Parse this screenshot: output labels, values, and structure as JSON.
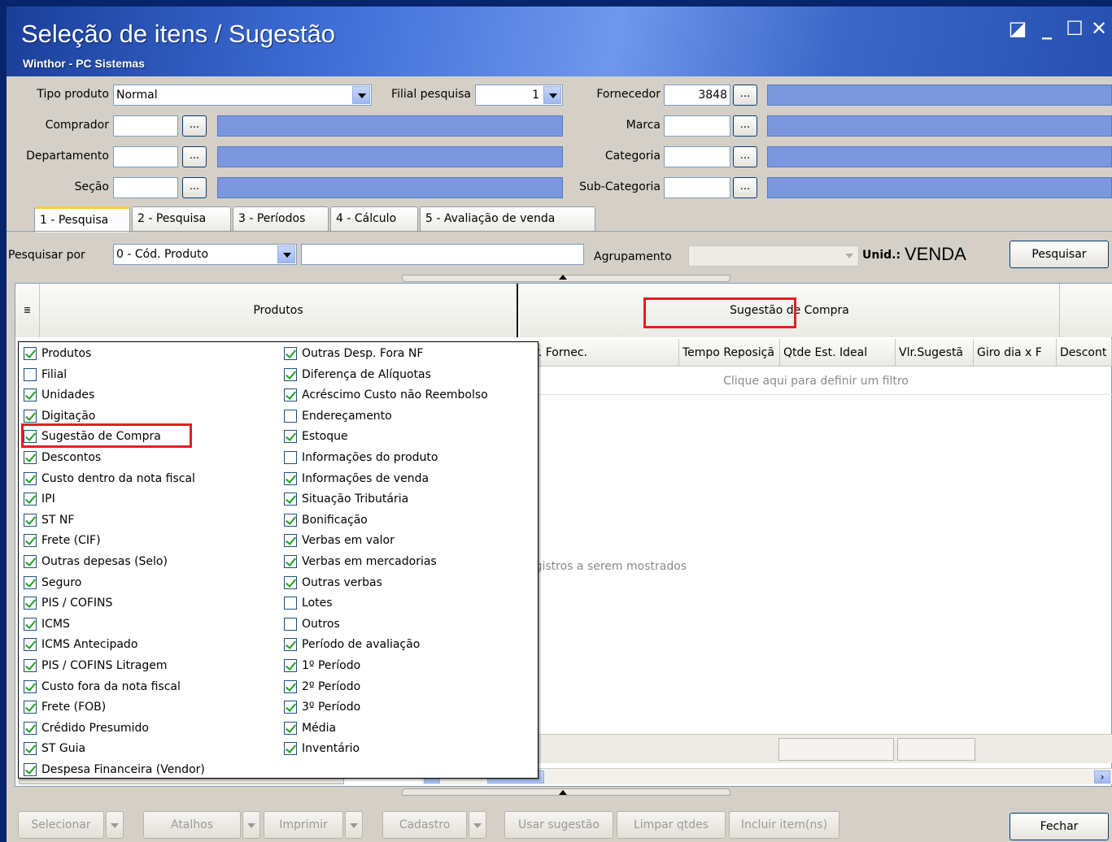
{
  "window": {
    "title": "Seleção de itens / Sugestão",
    "subtitle": "Winthor - PC Sistemas",
    "controls": [
      "◪",
      "_",
      "☐",
      "✕"
    ]
  },
  "filters": {
    "tipo_produto_label": "Tipo produto",
    "tipo_produto_value": "Normal",
    "filial_label": "Filial pesquisa",
    "filial_value": "1",
    "fornecedor_label": "Fornecedor",
    "fornecedor_value": "3848",
    "comprador_label": "Comprador",
    "marca_label": "Marca",
    "departamento_label": "Departamento",
    "categoria_label": "Categoria",
    "secao_label": "Seção",
    "subcategoria_label": "Sub-Categoria",
    "ellipsis": "..."
  },
  "tabs": [
    {
      "label": "1 - Pesquisa"
    },
    {
      "label": "2 - Pesquisa"
    },
    {
      "label": "3 - Períodos"
    },
    {
      "label": "4 - Cálculo"
    },
    {
      "label": "5 - Avaliação de venda"
    }
  ],
  "search": {
    "pesquisar_por_label": "Pesquisar por",
    "pesquisar_por_value": "0 - Cód. Produto",
    "agrupamento_label": "Agrupamento",
    "unid_label": "Unid.:",
    "unid_value": "VENDA",
    "pesquisar_button": "Pesquisar"
  },
  "grid": {
    "band_produtos": "Produtos",
    "band_sugestao": "Sugestão de Compra",
    "columns": [
      "ntr. Fornec.",
      "Tempo Reposiçã",
      "Qtde Est. Ideal",
      "Vlr.Sugestã",
      "Giro dia x F",
      "Descont"
    ],
    "filter_hint": "Clique aqui para definir um filtro",
    "empty_text": "egistros a serem mostrados"
  },
  "popup": {
    "left_items": [
      {
        "label": "Produtos",
        "checked": true
      },
      {
        "label": "Filial",
        "checked": false
      },
      {
        "label": "Unidades",
        "checked": true
      },
      {
        "label": "Digitação",
        "checked": true
      },
      {
        "label": "Sugestão de Compra",
        "checked": true
      },
      {
        "label": "Descontos",
        "checked": true
      },
      {
        "label": "Custo dentro da nota fiscal",
        "checked": true
      },
      {
        "label": "IPI",
        "checked": true
      },
      {
        "label": "ST NF",
        "checked": true
      },
      {
        "label": "Frete (CIF)",
        "checked": true
      },
      {
        "label": "Outras depesas (Selo)",
        "checked": true
      },
      {
        "label": "Seguro",
        "checked": true
      },
      {
        "label": "PIS / COFINS",
        "checked": true
      },
      {
        "label": "ICMS",
        "checked": true
      },
      {
        "label": "ICMS Antecipado",
        "checked": true
      },
      {
        "label": "PIS / COFINS Litragem",
        "checked": true
      },
      {
        "label": "Custo fora da nota fiscal",
        "checked": true
      },
      {
        "label": "Frete (FOB)",
        "checked": true
      },
      {
        "label": "Crédido Presumido",
        "checked": true
      },
      {
        "label": "ST Guia",
        "checked": true
      },
      {
        "label": "Despesa Financeira (Vendor)",
        "checked": true
      }
    ],
    "right_items": [
      {
        "label": "Outras Desp. Fora NF",
        "checked": true
      },
      {
        "label": "Diferença de Alíquotas",
        "checked": true
      },
      {
        "label": "Acréscimo Custo não Reembolso",
        "checked": true
      },
      {
        "label": "Endereçamento",
        "checked": false
      },
      {
        "label": "Estoque",
        "checked": true
      },
      {
        "label": "Informações do produto",
        "checked": false
      },
      {
        "label": "Informações de venda",
        "checked": true
      },
      {
        "label": "Situação Tributária",
        "checked": true
      },
      {
        "label": "Bonificação",
        "checked": true
      },
      {
        "label": "Verbas em valor",
        "checked": true
      },
      {
        "label": "Verbas em mercadorias",
        "checked": true
      },
      {
        "label": "Outras verbas",
        "checked": true
      },
      {
        "label": "Lotes",
        "checked": false
      },
      {
        "label": "Outros",
        "checked": false
      },
      {
        "label": "Período de avaliação",
        "checked": true
      },
      {
        "label": "1º Período",
        "checked": true
      },
      {
        "label": "2º Período",
        "checked": true
      },
      {
        "label": "3º Período",
        "checked": true
      },
      {
        "label": "Média",
        "checked": true
      },
      {
        "label": "Inventário",
        "checked": true
      }
    ]
  },
  "bottom": {
    "selecionar": "Selecionar",
    "atalhos": "Atalhos",
    "imprimir": "Imprimir",
    "cadastro": "Cadastro",
    "usar_sugestao": "Usar sugestão",
    "limpar_qtdes": "Limpar qtdes",
    "incluir_itens": "Incluir item(ns)",
    "fechar": "Fechar"
  },
  "colors": {
    "title_bar": "#3f6fd8",
    "highlight": "#e02020",
    "lookup_fill": "#7b98de"
  }
}
